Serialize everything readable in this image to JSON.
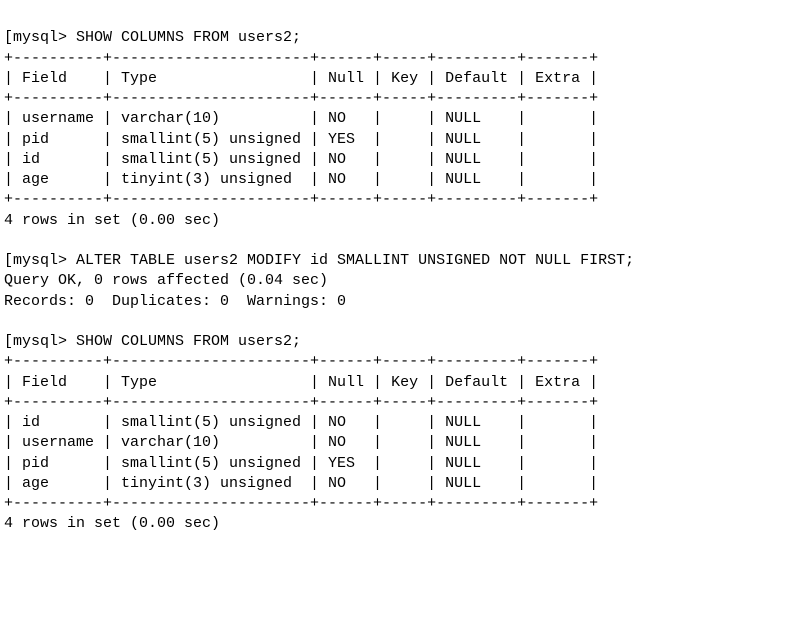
{
  "prompt": "[mysql> ",
  "commands": {
    "show1": "SHOW COLUMNS FROM users2;",
    "alter": "ALTER TABLE users2 MODIFY id SMALLINT UNSIGNED NOT NULL FIRST;",
    "show2": "SHOW COLUMNS FROM users2;"
  },
  "alter_result": {
    "line1": "Query OK, 0 rows affected (0.04 sec)",
    "line2": "Records: 0  Duplicates: 0  Warnings: 0"
  },
  "summary1": "4 rows in set (0.00 sec)",
  "summary2": "4 rows in set (0.00 sec)",
  "col_widths": {
    "Field": 10,
    "Type": 22,
    "Null": 6,
    "Key": 5,
    "Default": 9,
    "Extra": 7
  },
  "headers": [
    "Field",
    "Type",
    "Null",
    "Key",
    "Default",
    "Extra"
  ],
  "table1": [
    {
      "Field": "username",
      "Type": "varchar(10)",
      "Null": "NO",
      "Key": "",
      "Default": "NULL",
      "Extra": ""
    },
    {
      "Field": "pid",
      "Type": "smallint(5) unsigned",
      "Null": "YES",
      "Key": "",
      "Default": "NULL",
      "Extra": ""
    },
    {
      "Field": "id",
      "Type": "smallint(5) unsigned",
      "Null": "NO",
      "Key": "",
      "Default": "NULL",
      "Extra": ""
    },
    {
      "Field": "age",
      "Type": "tinyint(3) unsigned",
      "Null": "NO",
      "Key": "",
      "Default": "NULL",
      "Extra": ""
    }
  ],
  "table2": [
    {
      "Field": "id",
      "Type": "smallint(5) unsigned",
      "Null": "NO",
      "Key": "",
      "Default": "NULL",
      "Extra": ""
    },
    {
      "Field": "username",
      "Type": "varchar(10)",
      "Null": "NO",
      "Key": "",
      "Default": "NULL",
      "Extra": ""
    },
    {
      "Field": "pid",
      "Type": "smallint(5) unsigned",
      "Null": "YES",
      "Key": "",
      "Default": "NULL",
      "Extra": ""
    },
    {
      "Field": "age",
      "Type": "tinyint(3) unsigned",
      "Null": "NO",
      "Key": "",
      "Default": "NULL",
      "Extra": ""
    }
  ],
  "terminal": {
    "output": ""
  }
}
